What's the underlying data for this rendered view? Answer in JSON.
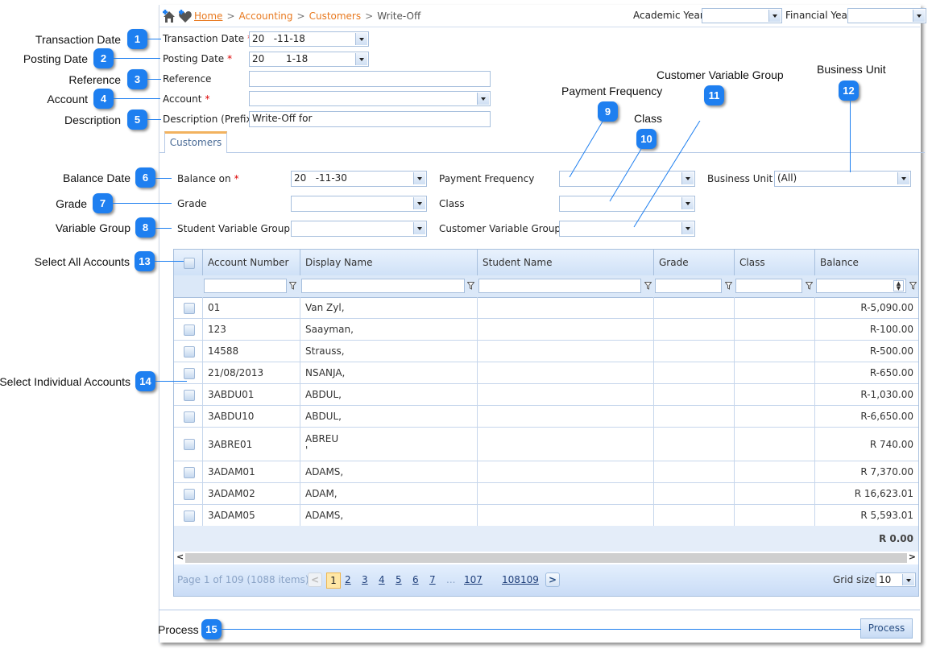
{
  "breadcrumb": {
    "items": [
      "Home",
      "Accounting",
      "Customers"
    ],
    "current": "Write-Off",
    "separator": ">"
  },
  "header": {
    "academic_year_label": "Academic Year",
    "academic_year_value": "",
    "financial_year_label": "Financial Year",
    "financial_year_value": ""
  },
  "form": {
    "transaction_date": {
      "label": "Transaction Date",
      "required": "*",
      "value": "20   -11-18"
    },
    "posting_date": {
      "label": "Posting Date",
      "required": "*",
      "value": "20       1-18"
    },
    "reference": {
      "label": "Reference",
      "value": ""
    },
    "account": {
      "label": "Account",
      "required": "*",
      "value": ""
    },
    "description": {
      "label": "Description (Prefix)",
      "value": "Write-Off for"
    }
  },
  "tabs": [
    {
      "label": "Customers",
      "active": true
    }
  ],
  "filters": {
    "balance_on": {
      "label": "Balance on",
      "required": "*",
      "value": "20   -11-30"
    },
    "grade": {
      "label": "Grade",
      "value": ""
    },
    "student_variable_group": {
      "label": "Student Variable Group",
      "value": ""
    },
    "payment_frequency": {
      "label": "Payment Frequency",
      "value": ""
    },
    "class": {
      "label": "Class",
      "value": ""
    },
    "customer_variable_group": {
      "label": "Customer Variable Group",
      "value": ""
    },
    "business_unit": {
      "label": "Business Unit",
      "value": "(All)"
    }
  },
  "grid": {
    "columns": [
      "Account Number",
      "Display Name",
      "Student Name",
      "Grade",
      "Class",
      "Balance"
    ],
    "rows": [
      {
        "account": "01",
        "name": "Van Zyl,",
        "student": "",
        "grade": "",
        "class": "",
        "balance": "R-5,090.00"
      },
      {
        "account": "123",
        "name": "Saayman,",
        "student": "",
        "grade": "",
        "class": "",
        "balance": "R-100.00"
      },
      {
        "account": "14588",
        "name": "Strauss,",
        "student": "",
        "grade": "",
        "class": "",
        "balance": "R-500.00"
      },
      {
        "account": "21/08/2013",
        "name": "NSANJA,",
        "student": "",
        "grade": "",
        "class": "",
        "balance": "R-650.00"
      },
      {
        "account": "3ABDU01",
        "name": "ABDUL,",
        "student": "",
        "grade": "",
        "class": "",
        "balance": "R-1,030.00"
      },
      {
        "account": "3ABDU10",
        "name": "ABDUL,",
        "student": "",
        "grade": "",
        "class": "",
        "balance": "R-6,650.00"
      },
      {
        "account": "3ABRE01",
        "name": "ABREU\n'",
        "student": "",
        "grade": "",
        "class": "",
        "balance": "R 740.00"
      },
      {
        "account": "3ADAM01",
        "name": "ADAMS,",
        "student": "",
        "grade": "",
        "class": "",
        "balance": "R 7,370.00"
      },
      {
        "account": "3ADAM02",
        "name": "ADAM,",
        "student": "",
        "grade": "",
        "class": "",
        "balance": "R 16,623.01"
      },
      {
        "account": "3ADAM05",
        "name": "ADAMS,",
        "student": "",
        "grade": "",
        "class": "",
        "balance": "R 5,593.01"
      }
    ],
    "total": "R 0.00",
    "pager": {
      "summary": "Page 1 of 109 (1088 items)",
      "pages": [
        "1",
        "2",
        "3",
        "4",
        "5",
        "6",
        "7",
        "...",
        "107",
        "108",
        "109"
      ],
      "current_page": "1",
      "grid_size_label": "Grid size:",
      "grid_size_value": "10"
    }
  },
  "actions": {
    "process_label": "Process"
  },
  "annotations": [
    {
      "num": "1",
      "label": "Transaction Date"
    },
    {
      "num": "2",
      "label": "Posting Date"
    },
    {
      "num": "3",
      "label": "Reference"
    },
    {
      "num": "4",
      "label": "Account"
    },
    {
      "num": "5",
      "label": "Description"
    },
    {
      "num": "6",
      "label": "Balance Date"
    },
    {
      "num": "7",
      "label": "Grade"
    },
    {
      "num": "8",
      "label": "Variable Group"
    },
    {
      "num": "9",
      "label": "Payment Frequency"
    },
    {
      "num": "10",
      "label": "Class"
    },
    {
      "num": "11",
      "label": "Customer Variable Group"
    },
    {
      "num": "12",
      "label": "Business Unit"
    },
    {
      "num": "13",
      "label": "Select All Accounts"
    },
    {
      "num": "14",
      "label": "Select Individual Accounts"
    },
    {
      "num": "15",
      "label": "Process"
    }
  ],
  "colors": {
    "accent": "#1e7ff0",
    "link": "#e8791f",
    "grid_border": "#a7bfdd"
  }
}
